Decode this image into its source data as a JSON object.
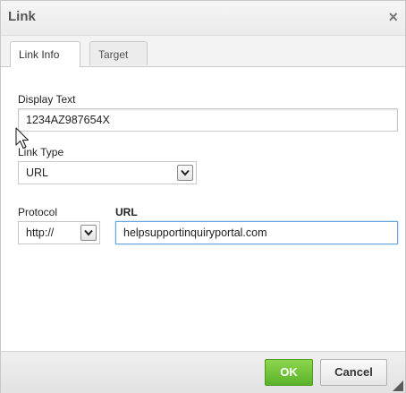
{
  "dialog": {
    "title": "Link",
    "close_symbol": "×"
  },
  "tabs": [
    {
      "label": "Link Info",
      "active": true
    },
    {
      "label": "Target",
      "active": false
    }
  ],
  "form": {
    "display_text": {
      "label": "Display Text",
      "value": "1234AZ987654X"
    },
    "link_type": {
      "label": "Link Type",
      "selected": "URL"
    },
    "protocol": {
      "label": "Protocol",
      "selected": "http://"
    },
    "url": {
      "label": "URL",
      "value": "helpsupportinquiryportal.com"
    }
  },
  "buttons": {
    "ok_label": "OK",
    "cancel_label": "Cancel"
  },
  "colors": {
    "ok_green": "#5ab22a",
    "focus_blue": "#6aa7e0"
  },
  "icons": [
    "close-icon",
    "chevron-down-icon",
    "mouse-cursor-icon",
    "resize-grip-icon"
  ]
}
